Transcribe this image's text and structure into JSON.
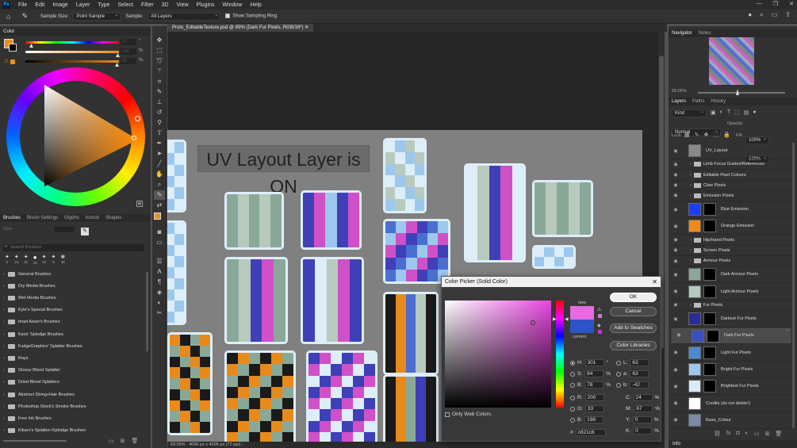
{
  "app": {
    "logo": "Ps"
  },
  "menu": [
    "File",
    "Edit",
    "Image",
    "Layer",
    "Type",
    "Select",
    "Filter",
    "3D",
    "View",
    "Plugins",
    "Window",
    "Help"
  ],
  "options_bar": {
    "sample_size_label": "Sample Size:",
    "sample_size_value": "Point Sample",
    "sample_label": "Sample:",
    "sample_value": "All Layers",
    "show_ring_label": "Show Sampling Ring"
  },
  "document": {
    "tab_title": "Proto_EditableTexture.psd @ 69% (Dark Fur Pixels, RGB/16*)",
    "status_zoom": "69.05%",
    "status_size": "4096 px x 4096 px (72 ppi)"
  },
  "canvas": {
    "banner_text": "UV Layout Layer is ON"
  },
  "color_panel": {
    "title": "Color",
    "fg_color": "#e8901a",
    "slider_values": [
      "37",
      "100",
      "95"
    ],
    "slider_units": [
      "°",
      "%",
      "%"
    ]
  },
  "brush_panel": {
    "tabs": [
      "Brushes",
      "Brush Settings",
      "Glyphs",
      "Iconsit",
      "Shapes"
    ],
    "size_label": "Size",
    "search_placeholder": "Search Brushes",
    "preset_sizes": [
      "4",
      "16",
      "11",
      "25",
      "33",
      "8",
      "36"
    ],
    "folders": [
      "General Brushes",
      "Dry Media Brushes",
      "Wet Media Brushes",
      "Kyle's Special Brushes",
      "Imad Awan's Brushes",
      "Kaos' Splodge Brushes",
      "FudgeGraphics' Splatter Brushes",
      "Rays",
      "Glossy Blood Splatter",
      "Dried Blood Splatters",
      "Abstract String+Hair Brushes",
      "Photoshop Stock's Smoke Brushes",
      "Free Ink Brushes",
      "Kikaru's Splatter+Splodge Brushes"
    ]
  },
  "color_picker": {
    "title": "Color Picker (Solid Color)",
    "new_label": "new",
    "current_label": "current",
    "new_color": "#e86ae0",
    "current_color": "#2d54c6",
    "buttons": {
      "ok": "OK",
      "cancel": "Cancel",
      "swatches": "Add to Swatches",
      "libraries": "Color Libraries"
    },
    "fields": {
      "H": "301",
      "S": "84",
      "B": "78",
      "R": "200",
      "G": "33",
      "Bl": "198",
      "L": "63",
      "a": "63",
      "b": "-42",
      "C": "24",
      "M": "67",
      "Y": "0",
      "K": "0"
    },
    "units": {
      "deg": "°",
      "pct": "%"
    },
    "web_only_label": "Only Web Colors",
    "hex_label": "#",
    "hex": "c821c6"
  },
  "navigator": {
    "tabs": [
      "Navigator",
      "Notes"
    ],
    "zoom": "69.05%"
  },
  "layers_panel": {
    "tabs": [
      "Layers",
      "Paths",
      "History"
    ],
    "kind_label": "Kind",
    "blend_mode": "Normal",
    "opacity_label": "Opacity:",
    "opacity": "100%",
    "lock_label": "Lock:",
    "fill_label": "Fill:",
    "fill": "100%",
    "info_label": "Info",
    "layers": [
      {
        "name": "UV_Layout",
        "type": "layer",
        "thumb": "#888888"
      },
      {
        "name": "Limb Focus Guides/References",
        "type": "group"
      },
      {
        "name": "Editable Pixel Colours",
        "type": "group"
      },
      {
        "name": "Claw Pixels",
        "type": "group"
      },
      {
        "name": "Emission Pixels",
        "type": "group"
      },
      {
        "name": "Blue Emission",
        "type": "layer",
        "thumb": "#1a3dff"
      },
      {
        "name": "Orange Emission",
        "type": "layer",
        "thumb": "#f08a1a"
      },
      {
        "name": "Hip/Hand Pixels",
        "type": "group"
      },
      {
        "name": "Screen Pixels",
        "type": "group"
      },
      {
        "name": "Armour Pixels",
        "type": "group"
      },
      {
        "name": "Dark Armour Pixels",
        "type": "layer",
        "thumb": "#8aa898"
      },
      {
        "name": "Light Armour Pixels",
        "type": "layer",
        "thumb": "#b4cabd"
      },
      {
        "name": "Fur Pixels",
        "type": "group"
      },
      {
        "name": "Darkest Fur Pixels",
        "type": "layer",
        "thumb": "#2a2a9a"
      },
      {
        "name": "Dark Fur Pixels",
        "type": "layer",
        "thumb": "#3a4fc0",
        "selected": true
      },
      {
        "name": "Light Fur Pixels",
        "type": "layer",
        "thumb": "#4a8ad0"
      },
      {
        "name": "Bright Fur Pixels",
        "type": "layer",
        "thumb": "#9cc8ee"
      },
      {
        "name": "Brightest Fur Pixels",
        "type": "layer",
        "thumb": "#d8eaf8"
      },
      {
        "name": "Credits (do not delete!)",
        "type": "layer",
        "thumb": "#ffffff"
      },
      {
        "name": "Base_Colour",
        "type": "layer",
        "thumb": "#7a8aa8"
      }
    ]
  }
}
